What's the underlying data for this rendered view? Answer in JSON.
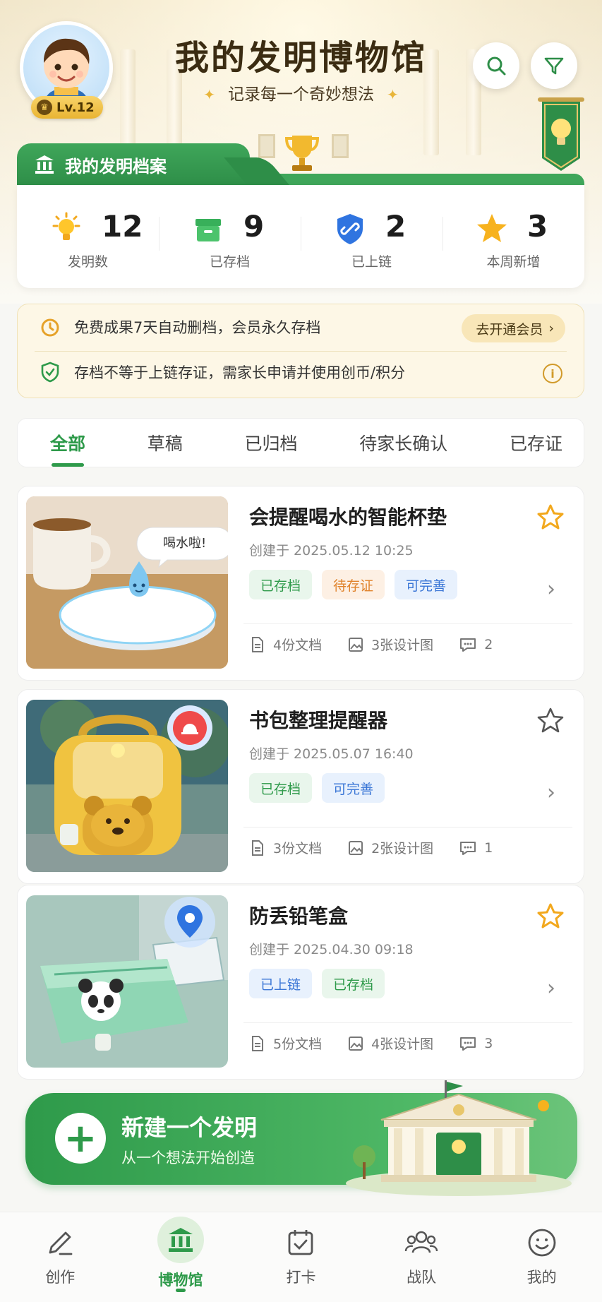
{
  "header": {
    "title": "我的发明博物馆",
    "subtitle": "记录每一个奇妙想法",
    "level": "Lv.12"
  },
  "archive": {
    "tab_label": "我的发明档案",
    "stats": [
      {
        "icon": "lightbulb-icon",
        "value": "12",
        "label": "发明数"
      },
      {
        "icon": "archive-box-icon",
        "value": "9",
        "label": "已存档"
      },
      {
        "icon": "chain-shield-icon",
        "value": "2",
        "label": "已上链"
      },
      {
        "icon": "star-icon",
        "value": "3",
        "label": "本周新增"
      }
    ]
  },
  "notice": {
    "line1": "免费成果7天自动删档，会员永久存档",
    "vip_button": "去开通会员",
    "line2": "存档不等于上链存证，需家长申请并使用创币/积分"
  },
  "tabs": [
    "全部",
    "草稿",
    "已归档",
    "待家长确认",
    "已存证"
  ],
  "active_tab": "全部",
  "inventions": [
    {
      "name": "会提醒喝水的智能杯垫",
      "date": "创建于 2025.05.12 10:25",
      "starred": true,
      "chips": [
        {
          "label": "已存档",
          "color": "green"
        },
        {
          "label": "待存证",
          "color": "orange"
        },
        {
          "label": "可完善",
          "color": "blue"
        }
      ],
      "docs": "4份文档",
      "designs": "3张设计图",
      "comments": "2",
      "bubble": "喝水啦!"
    },
    {
      "name": "书包整理提醒器",
      "date": "创建于 2025.05.07 16:40",
      "starred": false,
      "chips": [
        {
          "label": "已存档",
          "color": "green"
        },
        {
          "label": "可完善",
          "color": "blue"
        }
      ],
      "docs": "3份文档",
      "designs": "2张设计图",
      "comments": "1"
    },
    {
      "name": "防丢铅笔盒",
      "date": "创建于 2025.04.30 09:18",
      "starred": true,
      "chips": [
        {
          "label": "已上链",
          "color": "blue"
        },
        {
          "label": "已存档",
          "color": "green"
        }
      ],
      "docs": "5份文档",
      "designs": "4张设计图",
      "comments": "3"
    }
  ],
  "new_invention": {
    "title": "新建一个发明",
    "subtitle": "从一个想法开始创造"
  },
  "nav": [
    {
      "label": "创作",
      "icon": "pencil-icon"
    },
    {
      "label": "博物馆",
      "icon": "museum-icon",
      "active": true
    },
    {
      "label": "打卡",
      "icon": "calendar-check-icon"
    },
    {
      "label": "战队",
      "icon": "team-icon"
    },
    {
      "label": "我的",
      "icon": "smiley-icon"
    }
  ],
  "colors": {
    "brand_green": "#2e9a4a",
    "gold": "#e8b53a",
    "chip_orange": "#e0832c",
    "chip_blue": "#3a76d6"
  }
}
